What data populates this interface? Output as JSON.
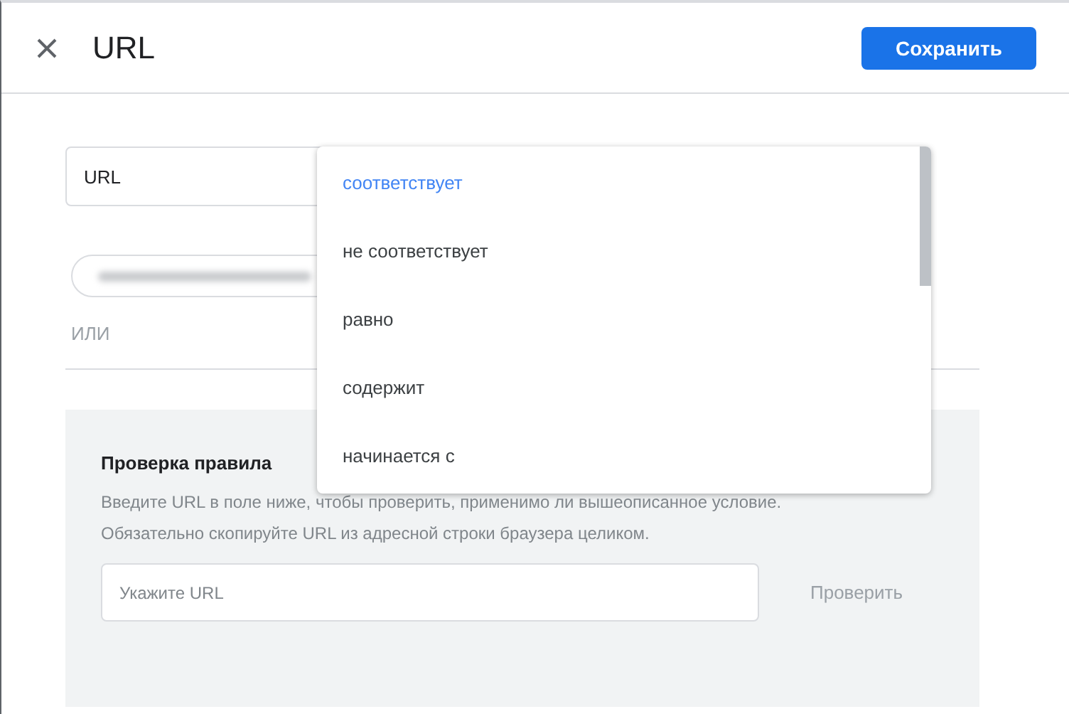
{
  "header": {
    "title": "URL",
    "save_button": "Сохранить"
  },
  "condition": {
    "field_value": "URL",
    "alternative": "ИЛИ"
  },
  "dropdown": {
    "options": [
      {
        "label": "соответствует",
        "selected": true
      },
      {
        "label": "не соответствует",
        "selected": false
      },
      {
        "label": "равно",
        "selected": false
      },
      {
        "label": "содержит",
        "selected": false
      },
      {
        "label": "начинается с",
        "selected": false
      }
    ]
  },
  "rule_check": {
    "title": "Проверка правила",
    "description": [
      "Введите URL в поле ниже, чтобы проверить, применимо ли вышеописанное условие.",
      "Обязательно скопируйте URL из адресной строки браузера целиком."
    ],
    "placeholder": "Укажите URL",
    "check_button": "Проверить"
  }
}
